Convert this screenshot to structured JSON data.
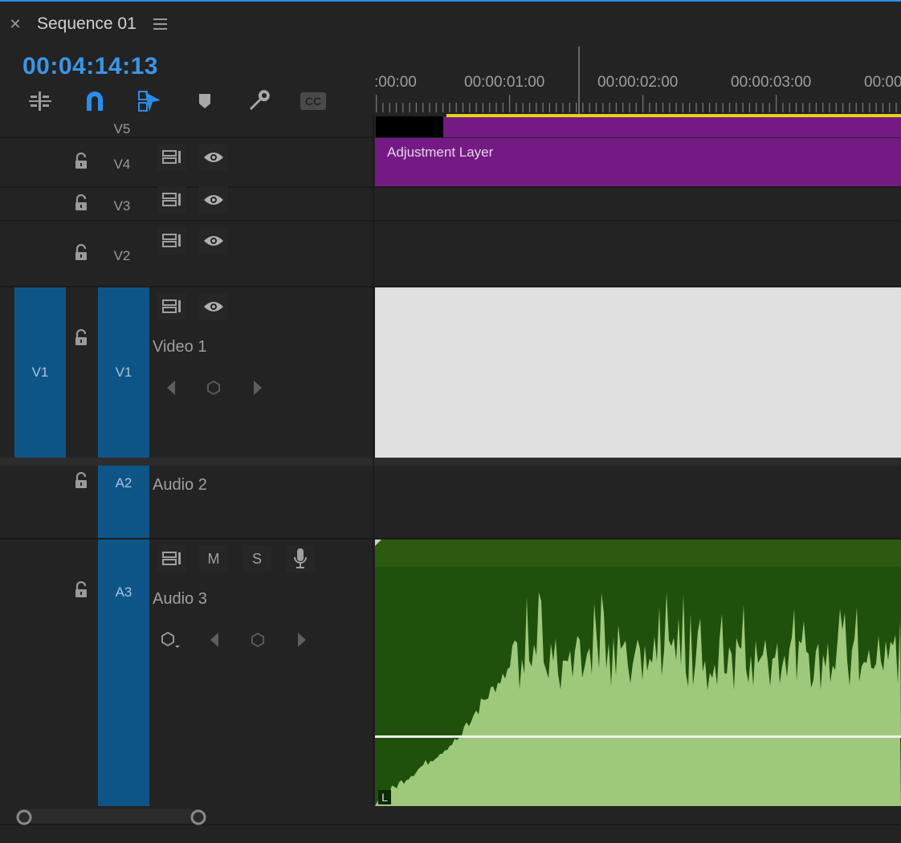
{
  "panel": {
    "tab_title": "Sequence 01",
    "timecode": "00:04:14:13"
  },
  "toolbar": {
    "tools": [
      {
        "name": "insert-edit-icon"
      },
      {
        "name": "snap-magnet-icon",
        "active": true
      },
      {
        "name": "linked-selection-icon",
        "active": true
      },
      {
        "name": "add-marker-icon"
      },
      {
        "name": "settings-wrench-icon"
      },
      {
        "name": "captions-cc-icon"
      }
    ]
  },
  "ruler": {
    "labels": [
      ":00:00",
      "00:00:01:00",
      "00:00:02:00",
      "00:00:03:00",
      "00:00"
    ]
  },
  "tracks": {
    "v5": {
      "label": "V5"
    },
    "v4": {
      "label": "V4"
    },
    "v3": {
      "label": "V3"
    },
    "v2": {
      "label": "V2"
    },
    "v1": {
      "source": "V1",
      "label": "V1",
      "name": "Video 1"
    },
    "a2": {
      "label": "A2",
      "name": "Audio 2"
    },
    "a3": {
      "label": "A3",
      "name": "Audio 3",
      "mute": "M",
      "solo": "S"
    }
  },
  "clips": {
    "adjustment_layer": "Adjustment Layer",
    "audio_channel_label": "L"
  },
  "colors": {
    "accent": "#2d8ceb",
    "timecode": "#3a96e8",
    "track_target": "#0e5587",
    "adjustment_clip": "#751a84",
    "audio_clip_dark": "#1f500c",
    "audio_waveform": "#9fc97a",
    "render_bar": "#e6d21c"
  }
}
